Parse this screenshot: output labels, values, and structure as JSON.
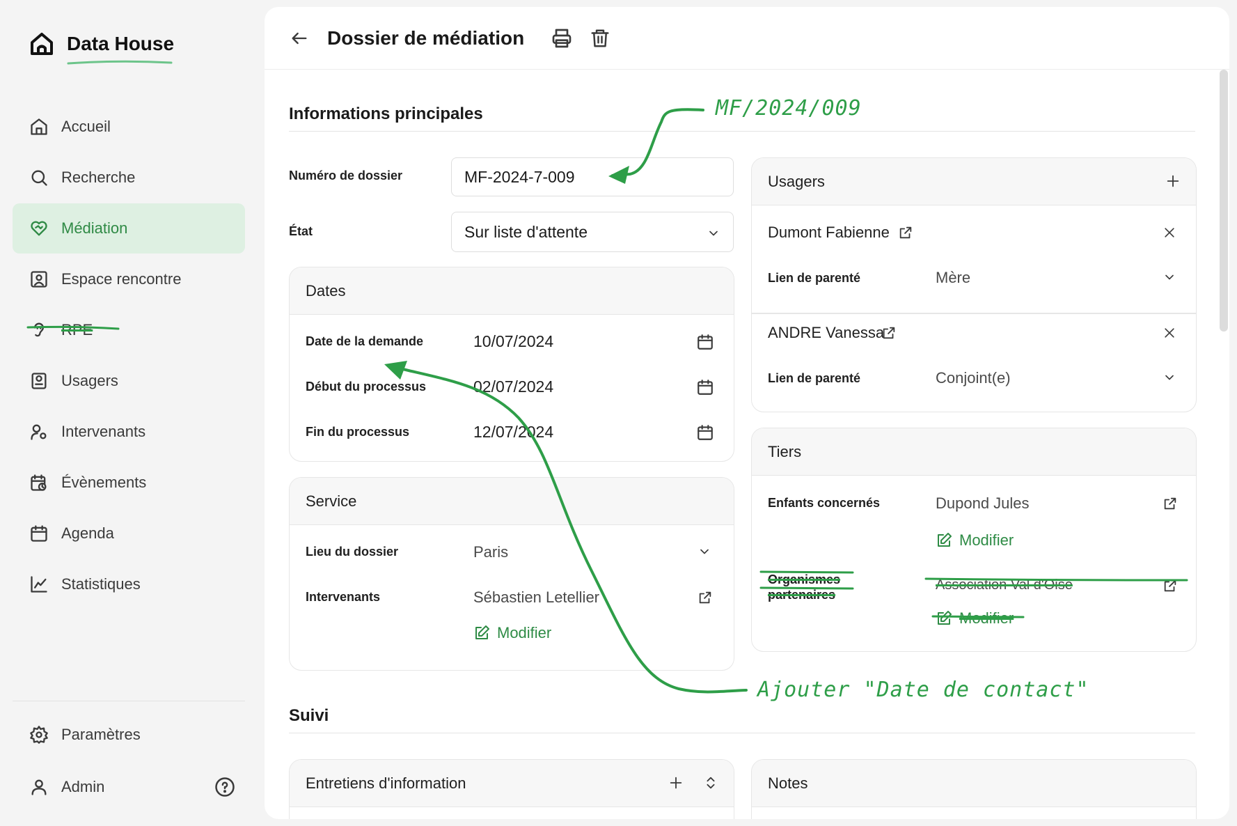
{
  "app": {
    "name": "Data House"
  },
  "sidebar": {
    "items": [
      {
        "label": "Accueil",
        "icon": "home-icon"
      },
      {
        "label": "Recherche",
        "icon": "search-icon"
      },
      {
        "label": "Médiation",
        "icon": "heart-handshake-icon",
        "active": true
      },
      {
        "label": "Espace rencontre",
        "icon": "contact-icon"
      },
      {
        "label": "RPE",
        "icon": "ear-icon",
        "struck": true
      },
      {
        "label": "Usagers",
        "icon": "user-card-icon"
      },
      {
        "label": "Intervenants",
        "icon": "user-gear-icon"
      },
      {
        "label": "Évènements",
        "icon": "calendar-clock-icon"
      },
      {
        "label": "Agenda",
        "icon": "calendar-icon"
      },
      {
        "label": "Statistiques",
        "icon": "chart-line-icon"
      }
    ],
    "bottom": [
      {
        "label": "Paramètres",
        "icon": "gear-icon"
      },
      {
        "label": "Admin",
        "icon": "user-icon"
      }
    ]
  },
  "page": {
    "title": "Dossier de médiation"
  },
  "info": {
    "title": "Informations principales",
    "dossier_label": "Numéro de dossier",
    "dossier_value": "MF-2024-7-009",
    "etat_label": "État",
    "etat_value": "Sur liste d'attente"
  },
  "dates": {
    "title": "Dates",
    "rows": [
      {
        "label": "Date de la demande",
        "value": "10/07/2024"
      },
      {
        "label": "Début du processus",
        "value": "02/07/2024"
      },
      {
        "label": "Fin du processus",
        "value": "12/07/2024"
      }
    ]
  },
  "service": {
    "title": "Service",
    "lieu_label": "Lieu du dossier",
    "lieu_value": "Paris",
    "intervenants_label": "Intervenants",
    "intervenants_value": "Sébastien Letellier",
    "modify_label": "Modifier"
  },
  "usagers": {
    "title": "Usagers",
    "people": [
      {
        "name": "Dumont Fabienne",
        "relation_label": "Lien de parenté",
        "relation_value": "Mère"
      },
      {
        "name": "ANDRE Vanessa",
        "relation_label": "Lien de parenté",
        "relation_value": "Conjoint(e)"
      }
    ]
  },
  "tiers": {
    "title": "Tiers",
    "enfants_label": "Enfants concernés",
    "enfants_value": "Dupond Jules",
    "modify_label": "Modifier",
    "orgs_label_1": "Organismes",
    "orgs_label_2": "partenaires",
    "orgs_value": "Association Val d'Oise",
    "orgs_modify_label": "Modifier"
  },
  "suivi": {
    "title": "Suivi",
    "entretiens_title": "Entretiens d'information",
    "notes_title": "Notes"
  },
  "annotations": {
    "dossier_note": "MF/2024/009",
    "dates_note": "Ajouter \"Date de contact\"",
    "color": "#2e9e48"
  }
}
